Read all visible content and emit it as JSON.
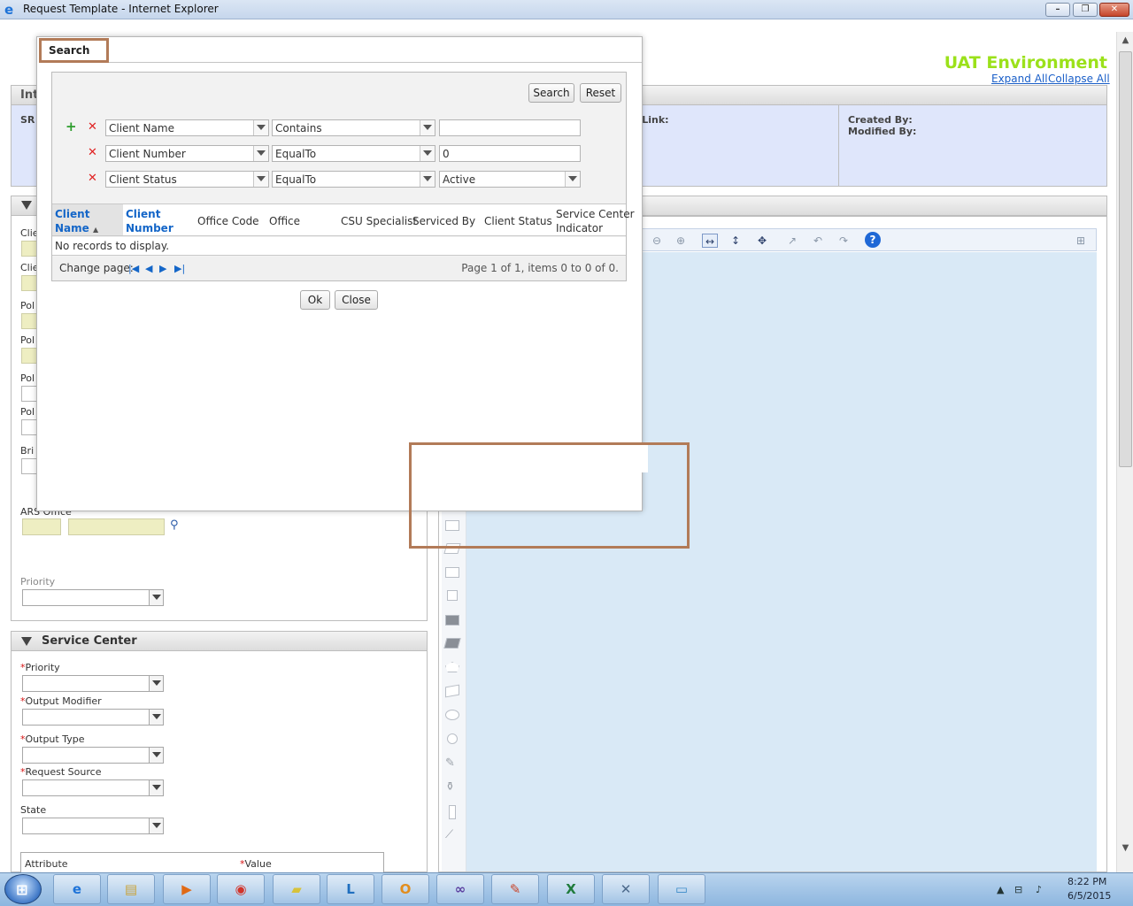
{
  "window": {
    "title": "Request Template - Internet Explorer",
    "minimize": "–",
    "restore": "❐",
    "close": "✕"
  },
  "header": {
    "environment": "UAT Environment",
    "expand_all": "Expand All",
    "collapse_all": "Collapse All"
  },
  "info_panel": {
    "title": "Int",
    "sr_label": "SR",
    "link_label": ": Link:",
    "created_by": "Created By:",
    "modified_by": "Modified By:"
  },
  "left_form": {
    "labels": [
      "Clie",
      "Clie",
      "Pol",
      "Pol",
      "Pol",
      "Pol",
      "Bri"
    ],
    "ars_office": "ARS Office",
    "priority": "Priority"
  },
  "service_center": {
    "title": "Service Center",
    "required_mark": "*",
    "fields": {
      "priority": "Priority",
      "output_modifier": "Output Modifier",
      "output_type": "Output Type",
      "request_source": "Request Source",
      "state": "State"
    },
    "attr_table": {
      "col_attribute": "Attribute",
      "col_value": "Value"
    }
  },
  "search_modal": {
    "tab_label": "Search",
    "search_button": "Search",
    "reset_button": "Reset",
    "add_mark": "+",
    "remove_mark": "✕",
    "criteria": [
      {
        "field": "Client Name",
        "operator": "Contains",
        "value": ""
      },
      {
        "field": "Client Number",
        "operator": "EqualTo",
        "value": "0"
      },
      {
        "field": "Client Status",
        "operator": "EqualTo",
        "value": "Active"
      }
    ],
    "grid": {
      "columns": [
        {
          "label": "Client\nName",
          "sorted": "ascending"
        },
        {
          "label": "Client\nNumber"
        },
        {
          "label": "Office Code"
        },
        {
          "label": "Office"
        },
        {
          "label": "CSU Specialist"
        },
        {
          "label": "Serviced By"
        },
        {
          "label": "Client Status"
        },
        {
          "label": "Service Center\nIndicator"
        }
      ],
      "sort_arrow": "▲",
      "empty_text": "No records to display.",
      "change_page": "Change page:",
      "page_info": "Page 1 of 1, items 0 to 0 of 0."
    },
    "ok_button": "Ok",
    "close_button": "Close"
  },
  "taskbar": {
    "time": "8:22 PM",
    "date": "6/5/2015",
    "apps": [
      "internet-explorer",
      "file-explorer",
      "media-player",
      "chrome",
      "sticky-notes",
      "lync",
      "outlook",
      "visual-studio",
      "paint-tool",
      "excel",
      "network-tool",
      "notepad"
    ]
  },
  "colors": {
    "environment": "#9be11a",
    "link": "#1a5fc8",
    "highlight_border": "#b27b58",
    "canvas": "#d9e9f6",
    "info_panel": "#dfe6fb"
  }
}
